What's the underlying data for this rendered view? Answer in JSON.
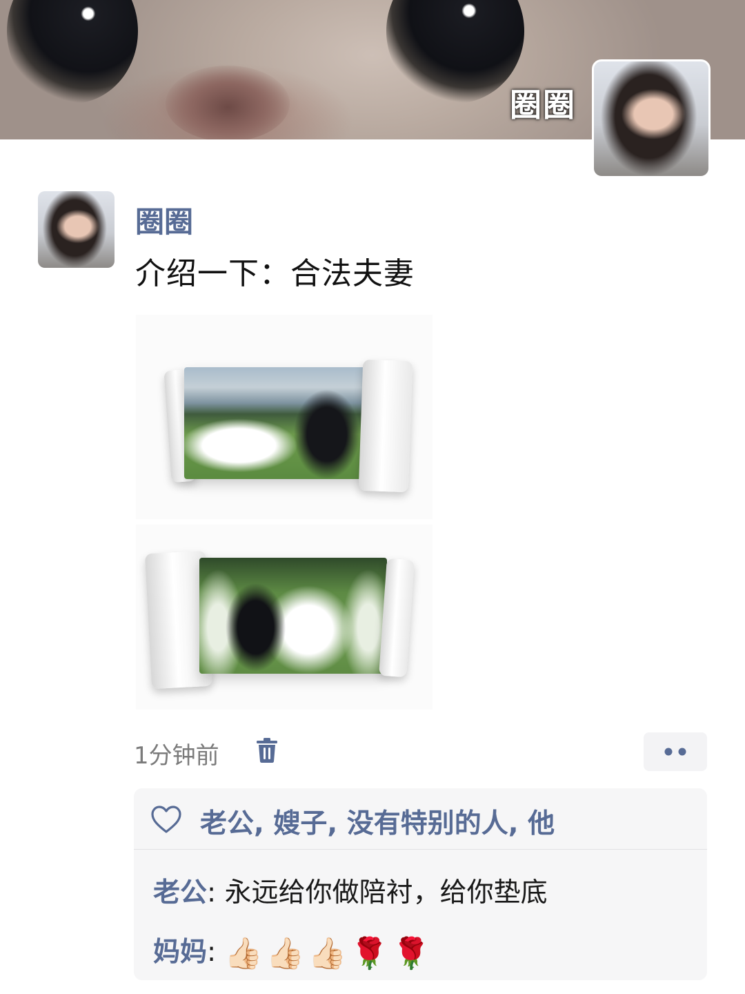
{
  "cover": {
    "name": "圈圈"
  },
  "post": {
    "author": "圈圈",
    "text": "介绍一下：合法夫妻",
    "photo_count": 2,
    "timestamp": "1分钟前"
  },
  "icons": {
    "delete": "trash-icon",
    "more": "more-dots-icon",
    "like": "heart-icon"
  },
  "interactions": {
    "likes_text": "老公, 嫂子, 没有特别的人, 他",
    "comments": [
      {
        "author": "老公",
        "colon": ": ",
        "text": "永远给你做陪衬，给你垫底"
      },
      {
        "author": "妈妈",
        "colon": ": ",
        "emojis": [
          "👍🏻",
          "👍🏻",
          "👍🏻",
          "🌹",
          "🌹"
        ]
      }
    ]
  },
  "colors": {
    "link": "#576b95",
    "text": "#111111",
    "muted": "#7b7b7b",
    "panel": "#f6f6f7"
  }
}
